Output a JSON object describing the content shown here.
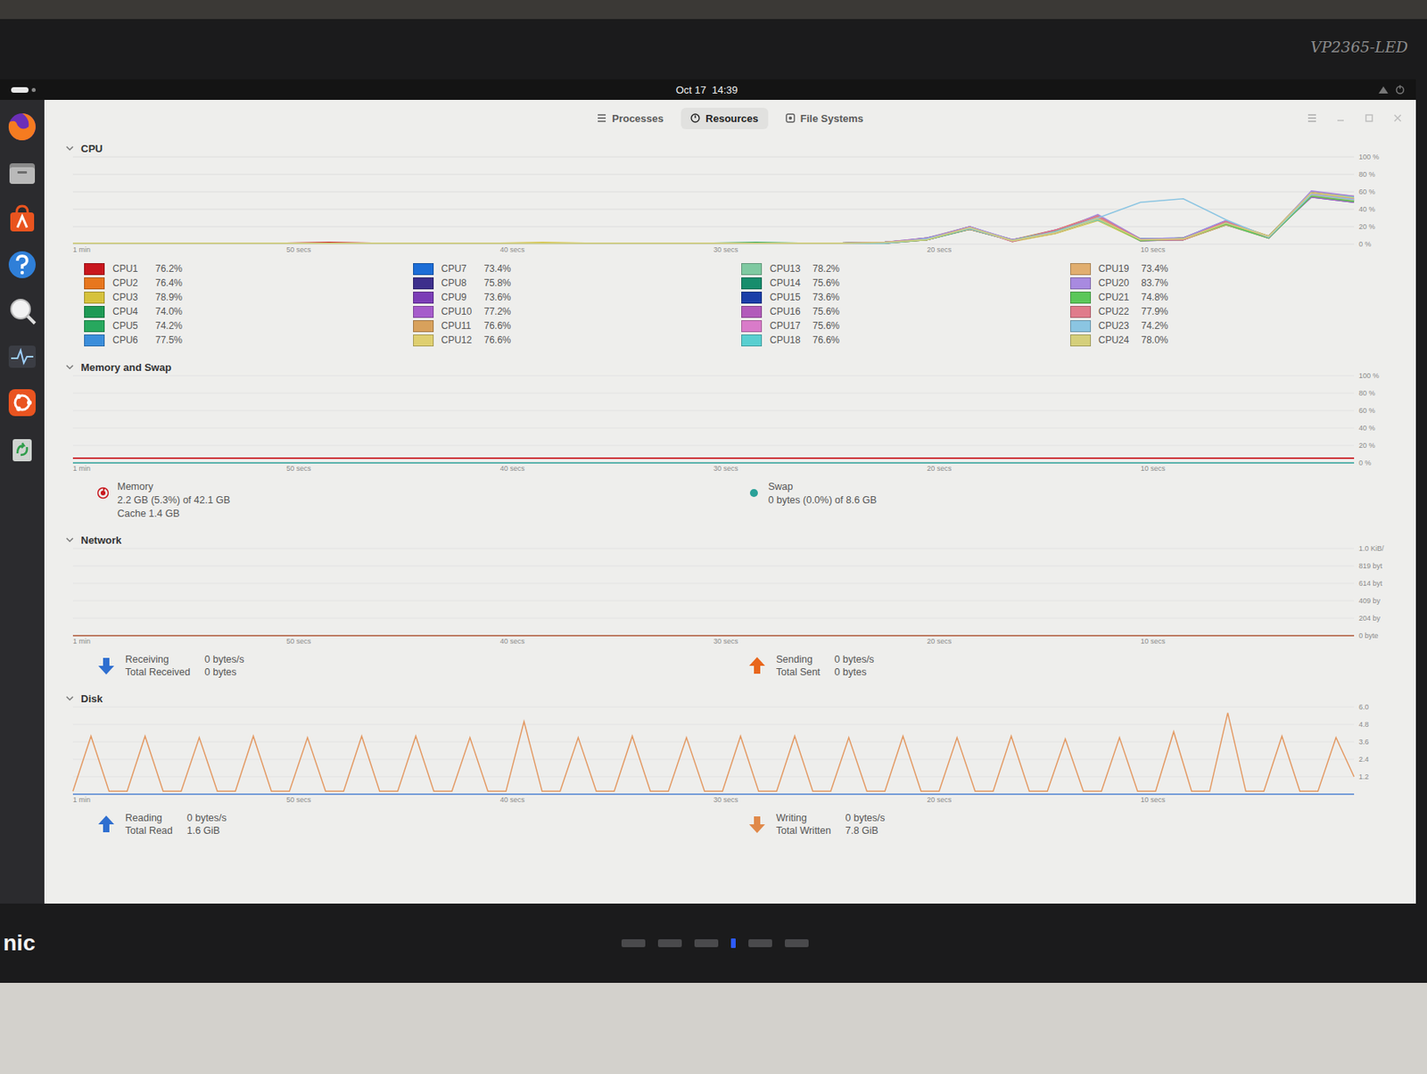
{
  "monitor": {
    "model": "VP2365-LED",
    "brand": "nic"
  },
  "top_bar": {
    "clock": "Oct 17  14:39"
  },
  "tabs": [
    {
      "label": "Processes",
      "selected": false
    },
    {
      "label": "Resources",
      "selected": true
    },
    {
      "label": "File Systems",
      "selected": false
    }
  ],
  "cpu": {
    "title": "CPU",
    "y_ticks": [
      "100 %",
      "80 %",
      "60 %",
      "40 %",
      "20 %",
      "0 %"
    ],
    "x_ticks": [
      "1 min",
      "50 secs",
      "40 secs",
      "30 secs",
      "20 secs",
      "10 secs"
    ],
    "series": [
      {
        "name": "CPU1",
        "value": "76.2%",
        "color": "#c8161d",
        "values": [
          1,
          1,
          1,
          1,
          1,
          1,
          2,
          1,
          1,
          1,
          1,
          1,
          1,
          1,
          1,
          1,
          1,
          1,
          1,
          2,
          6,
          19,
          4,
          14,
          30,
          5,
          6,
          24,
          8,
          58,
          52
        ]
      },
      {
        "name": "CPU2",
        "value": "76.4%",
        "color": "#e8771e",
        "values": [
          1,
          1,
          1,
          1,
          1,
          1,
          1,
          1,
          1,
          1,
          1,
          1,
          1,
          1,
          1,
          1,
          1,
          1,
          1,
          2,
          5,
          18,
          5,
          16,
          33,
          6,
          5,
          22,
          7,
          56,
          50
        ]
      },
      {
        "name": "CPU3",
        "value": "78.9%",
        "color": "#d6c23c",
        "values": [
          1,
          1,
          1,
          1,
          1,
          1,
          1,
          1,
          1,
          1,
          1,
          2,
          1,
          1,
          1,
          1,
          1,
          1,
          1,
          1,
          7,
          20,
          3,
          12,
          27,
          4,
          7,
          26,
          9,
          60,
          54
        ]
      },
      {
        "name": "CPU4",
        "value": "74.0%",
        "color": "#1e9a55",
        "values": [
          1,
          1,
          1,
          1,
          1,
          1,
          1,
          1,
          1,
          1,
          1,
          1,
          1,
          1,
          1,
          1,
          1,
          1,
          1,
          2,
          6,
          17,
          4,
          15,
          31,
          5,
          6,
          23,
          8,
          55,
          49
        ]
      },
      {
        "name": "CPU5",
        "value": "74.2%",
        "color": "#27a85e",
        "values": [
          1,
          1,
          1,
          1,
          1,
          1,
          1,
          1,
          1,
          1,
          1,
          1,
          1,
          1,
          1,
          1,
          2,
          1,
          1,
          1,
          5,
          19,
          4,
          13,
          29,
          5,
          5,
          25,
          7,
          57,
          51
        ]
      },
      {
        "name": "CPU6",
        "value": "77.5%",
        "color": "#3b8edb",
        "values": [
          1,
          1,
          1,
          1,
          1,
          1,
          1,
          1,
          1,
          1,
          1,
          1,
          1,
          1,
          1,
          1,
          1,
          1,
          1,
          2,
          6,
          18,
          5,
          14,
          28,
          6,
          7,
          27,
          8,
          59,
          53
        ]
      },
      {
        "name": "CPU7",
        "value": "73.4%",
        "color": "#1c6dd6",
        "values": [
          1,
          1,
          1,
          1,
          1,
          1,
          1,
          1,
          1,
          1,
          1,
          1,
          1,
          1,
          1,
          1,
          1,
          1,
          1,
          1,
          6,
          20,
          4,
          15,
          32,
          5,
          6,
          22,
          9,
          54,
          48
        ]
      },
      {
        "name": "CPU8",
        "value": "75.8%",
        "color": "#3d2f8c",
        "values": [
          1,
          1,
          1,
          1,
          1,
          1,
          1,
          1,
          1,
          1,
          1,
          1,
          1,
          1,
          1,
          1,
          1,
          1,
          1,
          2,
          5,
          18,
          4,
          13,
          30,
          4,
          5,
          24,
          8,
          58,
          50
        ]
      },
      {
        "name": "CPU9",
        "value": "73.6%",
        "color": "#7b3db6",
        "values": [
          1,
          1,
          1,
          1,
          1,
          1,
          1,
          1,
          1,
          1,
          1,
          1,
          1,
          1,
          1,
          1,
          1,
          1,
          1,
          1,
          6,
          19,
          5,
          14,
          31,
          5,
          6,
          25,
          7,
          56,
          52
        ]
      },
      {
        "name": "CPU10",
        "value": "77.2%",
        "color": "#a65ccb",
        "values": [
          1,
          1,
          1,
          1,
          1,
          1,
          1,
          1,
          1,
          1,
          1,
          1,
          1,
          1,
          1,
          1,
          1,
          1,
          1,
          2,
          7,
          17,
          4,
          16,
          29,
          6,
          5,
          23,
          8,
          57,
          49
        ]
      },
      {
        "name": "CPU11",
        "value": "76.6%",
        "color": "#d8a15c",
        "values": [
          1,
          1,
          1,
          1,
          1,
          1,
          1,
          1,
          1,
          1,
          1,
          1,
          1,
          1,
          1,
          1,
          1,
          1,
          1,
          1,
          5,
          20,
          3,
          14,
          33,
          5,
          7,
          26,
          9,
          60,
          55
        ]
      },
      {
        "name": "CPU12",
        "value": "76.6%",
        "color": "#dfcf70",
        "values": [
          1,
          1,
          1,
          1,
          1,
          1,
          1,
          1,
          1,
          1,
          1,
          1,
          1,
          1,
          1,
          1,
          1,
          1,
          1,
          2,
          6,
          18,
          4,
          12,
          28,
          4,
          6,
          24,
          8,
          55,
          51
        ]
      },
      {
        "name": "CPU13",
        "value": "78.2%",
        "color": "#7fc9a1",
        "values": [
          1,
          1,
          1,
          1,
          1,
          1,
          1,
          1,
          1,
          1,
          1,
          1,
          1,
          1,
          1,
          1,
          1,
          1,
          1,
          1,
          6,
          19,
          5,
          15,
          30,
          5,
          5,
          22,
          7,
          58,
          53
        ]
      },
      {
        "name": "CPU14",
        "value": "75.6%",
        "color": "#178d6c",
        "values": [
          1,
          1,
          1,
          1,
          1,
          1,
          1,
          1,
          1,
          1,
          1,
          1,
          1,
          1,
          1,
          1,
          1,
          1,
          1,
          2,
          5,
          17,
          4,
          14,
          31,
          6,
          6,
          25,
          8,
          56,
          50
        ]
      },
      {
        "name": "CPU15",
        "value": "73.6%",
        "color": "#1a3ea8",
        "values": [
          1,
          1,
          1,
          1,
          1,
          1,
          1,
          1,
          1,
          1,
          1,
          1,
          1,
          1,
          1,
          1,
          1,
          1,
          1,
          1,
          7,
          18,
          4,
          13,
          29,
          5,
          7,
          23,
          9,
          59,
          52
        ]
      },
      {
        "name": "CPU16",
        "value": "75.6%",
        "color": "#b25bba",
        "values": [
          1,
          1,
          1,
          1,
          1,
          1,
          1,
          1,
          1,
          1,
          1,
          1,
          1,
          1,
          1,
          1,
          1,
          1,
          1,
          2,
          6,
          20,
          3,
          16,
          32,
          4,
          5,
          26,
          8,
          54,
          48
        ]
      },
      {
        "name": "CPU17",
        "value": "75.6%",
        "color": "#d97bc9",
        "values": [
          1,
          1,
          1,
          1,
          1,
          1,
          1,
          1,
          1,
          1,
          1,
          1,
          1,
          1,
          1,
          1,
          1,
          1,
          1,
          1,
          5,
          18,
          5,
          14,
          30,
          5,
          6,
          24,
          7,
          57,
          51
        ]
      },
      {
        "name": "CPU18",
        "value": "76.6%",
        "color": "#59cfd0",
        "values": [
          1,
          1,
          1,
          1,
          1,
          1,
          1,
          1,
          1,
          1,
          1,
          1,
          1,
          1,
          1,
          1,
          1,
          1,
          1,
          2,
          6,
          19,
          4,
          15,
          28,
          6,
          6,
          25,
          8,
          58,
          54
        ]
      },
      {
        "name": "CPU19",
        "value": "73.4%",
        "color": "#e1ae6f",
        "values": [
          1,
          1,
          1,
          1,
          1,
          1,
          1,
          1,
          1,
          1,
          1,
          1,
          1,
          1,
          1,
          1,
          1,
          1,
          1,
          1,
          6,
          17,
          4,
          13,
          31,
          5,
          5,
          22,
          9,
          56,
          50
        ]
      },
      {
        "name": "CPU20",
        "value": "83.7%",
        "color": "#a88ae0",
        "values": [
          1,
          1,
          1,
          1,
          1,
          1,
          1,
          1,
          1,
          1,
          1,
          1,
          1,
          1,
          1,
          1,
          1,
          1,
          1,
          2,
          7,
          20,
          5,
          14,
          34,
          6,
          7,
          27,
          8,
          61,
          55
        ]
      },
      {
        "name": "CPU21",
        "value": "74.8%",
        "color": "#5bc759",
        "values": [
          1,
          1,
          1,
          1,
          1,
          1,
          1,
          1,
          1,
          1,
          1,
          1,
          1,
          1,
          1,
          1,
          1,
          1,
          1,
          1,
          5,
          18,
          4,
          15,
          29,
          4,
          6,
          23,
          7,
          55,
          49
        ]
      },
      {
        "name": "CPU22",
        "value": "77.9%",
        "color": "#e07b8b",
        "values": [
          1,
          1,
          1,
          1,
          1,
          1,
          1,
          1,
          1,
          1,
          1,
          1,
          1,
          1,
          1,
          1,
          1,
          1,
          1,
          2,
          6,
          19,
          3,
          16,
          32,
          5,
          5,
          26,
          8,
          58,
          52
        ]
      },
      {
        "name": "CPU23",
        "value": "74.2%",
        "color": "#8bc5e2",
        "values": [
          1,
          1,
          1,
          1,
          1,
          1,
          1,
          1,
          1,
          1,
          1,
          1,
          1,
          1,
          1,
          1,
          1,
          1,
          1,
          1,
          6,
          18,
          4,
          14,
          30,
          48,
          52,
          28,
          8,
          57,
          51
        ]
      },
      {
        "name": "CPU24",
        "value": "78.0%",
        "color": "#d5cf7b",
        "values": [
          1,
          1,
          1,
          1,
          1,
          1,
          1,
          1,
          1,
          1,
          1,
          1,
          1,
          1,
          1,
          1,
          1,
          1,
          1,
          2,
          5,
          19,
          4,
          13,
          29,
          5,
          6,
          24,
          9,
          59,
          53
        ]
      }
    ]
  },
  "memory": {
    "title": "Memory and Swap",
    "y_ticks": [
      "100 %",
      "80 %",
      "60 %",
      "40 %",
      "20 %",
      "0 %"
    ],
    "x_ticks": [
      "1 min",
      "50 secs",
      "40 secs",
      "30 secs",
      "20 secs",
      "10 secs"
    ],
    "items": [
      {
        "kind": "pie",
        "label": "Memory",
        "detail": "2.2 GB (5.3%) of 42.1 GB",
        "extra": "Cache 1.4 GB",
        "color": "#c8161d",
        "values": [
          5.3,
          5.3,
          5.3,
          5.3,
          5.3,
          5.3,
          5.3,
          5.3,
          5.3,
          5.3,
          5.3,
          5.3,
          5.3,
          5.3,
          5.3,
          5.3
        ]
      },
      {
        "kind": "dot",
        "label": "Swap",
        "detail": "0 bytes (0.0%) of 8.6 GB",
        "extra": "",
        "color": "#2aa198",
        "values": [
          0,
          0,
          0,
          0,
          0,
          0,
          0,
          0,
          0,
          0,
          0,
          0,
          0,
          0,
          0,
          0
        ]
      }
    ]
  },
  "network": {
    "title": "Network",
    "y_ticks": [
      "1.0 KiB/",
      "819 byt",
      "614 byt",
      "409 by",
      "204 by",
      "0 byte"
    ],
    "x_ticks": [
      "1 min",
      "50 secs",
      "40 secs",
      "30 secs",
      "20 secs",
      "10 secs"
    ],
    "items": [
      {
        "kind": "down",
        "label": "Receiving",
        "rate": "0 bytes/s",
        "total_label": "Total Received",
        "total": "0 bytes",
        "color": "#2f6fd0",
        "values": [
          0,
          0,
          0,
          0,
          0,
          0,
          0,
          0,
          0,
          0,
          0,
          0,
          0,
          0,
          0,
          0
        ]
      },
      {
        "kind": "up",
        "label": "Sending",
        "rate": "0 bytes/s",
        "total_label": "Total Sent",
        "total": "0 bytes",
        "color": "#e8661c",
        "values": [
          0,
          0,
          0,
          0,
          0,
          0,
          0,
          0,
          0,
          0,
          0,
          0,
          0,
          0,
          0,
          0
        ]
      }
    ]
  },
  "disk": {
    "title": "Disk",
    "y_ticks": [
      "6.0",
      "4.8",
      "3.6",
      "2.4",
      "1.2"
    ],
    "x_ticks": [
      "1 min",
      "50 secs",
      "40 secs",
      "30 secs",
      "20 secs",
      "10 secs"
    ],
    "items": [
      {
        "kind": "up",
        "label": "Reading",
        "rate": "0 bytes/s",
        "total_label": "Total Read",
        "total": "1.6 GiB",
        "color": "#2f6fd0",
        "values": [
          0,
          0,
          0,
          0,
          0,
          0,
          0,
          0,
          0,
          0,
          0,
          0,
          0,
          0,
          0,
          0
        ]
      },
      {
        "kind": "down",
        "label": "Writing",
        "rate": "0 bytes/s",
        "total_label": "Total Written",
        "total": "7.8 GiB",
        "color": "#e0894a",
        "values": [
          0.2,
          4.0,
          0.2,
          0.2,
          4.0,
          0.2,
          0.2,
          3.9,
          0.2,
          0.2,
          4.0,
          0.2,
          0.2,
          3.9,
          0.2,
          0.2,
          4.0,
          0.2,
          0.2,
          4.0,
          0.2,
          0.2,
          3.9,
          0.2,
          0.2,
          5.0,
          0.2,
          0.2,
          3.9,
          0.2,
          0.2,
          4.0,
          0.2,
          0.2,
          3.9,
          0.2,
          0.2,
          4.0,
          0.2,
          0.2,
          4.0,
          0.2,
          0.2,
          3.9,
          0.2,
          0.2,
          4.0,
          0.2,
          0.2,
          3.9,
          0.2,
          0.2,
          4.0,
          0.2,
          0.2,
          3.8,
          0.2,
          0.2,
          3.9,
          0.2,
          0.2,
          4.3,
          0.2,
          0.2,
          5.6,
          0.2,
          0.2,
          4.0,
          0.2,
          0.2,
          3.9,
          1.2
        ]
      }
    ]
  }
}
